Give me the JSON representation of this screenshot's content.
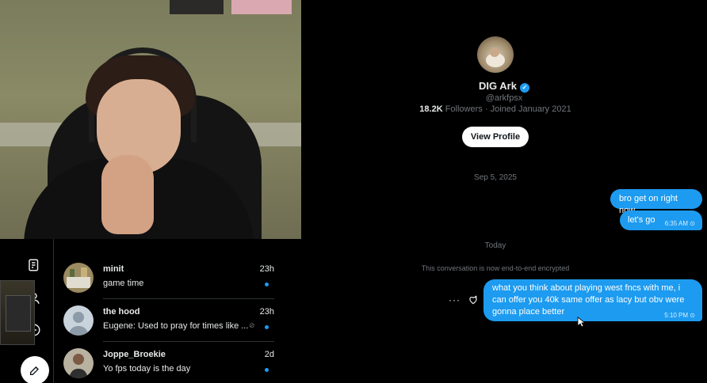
{
  "conversation": {
    "profile": {
      "name": "DIG Ark",
      "handle": "@arkfpsx",
      "followers_count": "18.2K",
      "followers_label": "Followers",
      "separator": "·",
      "joined": "Joined January 2021",
      "view_profile_label": "View Profile"
    },
    "date_sep_1": "Sep 5, 2025",
    "messages_1": [
      {
        "text": "bro get on right now",
        "time": ""
      },
      {
        "text": "let's go",
        "time": "6:35 AM"
      }
    ],
    "date_sep_2": "Today",
    "encryption_notice": "This conversation is now end-to-end encrypted",
    "messages_2": [
      {
        "text": "what you think about playing west fncs with me, i can offer you 40k same offer as lacy but obv were gonna place better",
        "time": "5:10 PM"
      }
    ],
    "more_label": "···",
    "accent": "#1d9bf0"
  },
  "dm_list": {
    "partial_preview": "...",
    "items": [
      {
        "name": "minit",
        "time": "23h",
        "preview": "game time"
      },
      {
        "name": "the hood",
        "time": "23h",
        "preview": "Eugene: Used to pray for times like ..."
      },
      {
        "name": "Joppe_Broekie",
        "time": "2d",
        "preview": "Yo fps today is the day"
      }
    ]
  }
}
